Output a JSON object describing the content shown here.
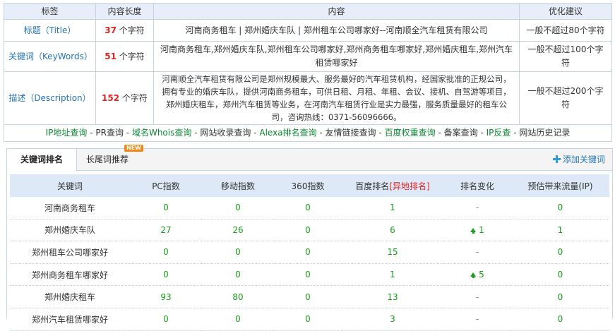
{
  "seo_table": {
    "headers": [
      "标签",
      "内容长度",
      "内容",
      "优化建议"
    ],
    "rows": [
      {
        "label": "标题（Title）",
        "count": "37",
        "unit": " 个字符",
        "content": "河南商务租车 | 郑州婚庆车队 | 郑州租车公司哪家好--河南顺全汽车租赁有限公司",
        "advice": "一般不超过80个字符"
      },
      {
        "label": "关键词（KeyWords）",
        "count": "51",
        "unit": " 个字符",
        "content": "河南商务租车,郑州婚庆车队,郑州租车公司哪家好,郑州商务租车哪家好,郑州婚庆租车,郑州汽车租赁哪家好",
        "advice": "一般不超过100个字符"
      },
      {
        "label": "描述（Description）",
        "count": "152",
        "unit": " 个字符",
        "content": "河南顺全汽车租赁有限公司是郑州规模最大、服务最好的汽车租赁机构，经国家批准的正规公司，拥有专业的婚庆车队，提供河南商务租车，可供日租、月租、年租、会议、接机、自驾游等项目，郑州婚庆租车，郑州汽车租赁等业务，在河南汽车租赁行业是实力最强，服务质量最好的租车公司，咨询热线：0371-56096666。",
        "advice": "一般不超过200个字符"
      }
    ],
    "tools": [
      {
        "label": "IP地址查询",
        "color": "green"
      },
      {
        "label": "PR查询",
        "color": "black"
      },
      {
        "label": "域名Whois查询",
        "color": "green"
      },
      {
        "label": "网站收录查询",
        "color": "black"
      },
      {
        "label": "Alexa排名查询",
        "color": "green"
      },
      {
        "label": "友情链接查询",
        "color": "black"
      },
      {
        "label": "百度权重查询",
        "color": "green"
      },
      {
        "label": "备案查询",
        "color": "black"
      },
      {
        "label": "IP反查",
        "color": "green"
      },
      {
        "label": "网站历史记录",
        "color": "black"
      }
    ],
    "tool_separator": "-"
  },
  "rank_panel": {
    "tabs": [
      "关键词排名",
      "长尾词推荐"
    ],
    "new_badge": "NEW",
    "add_keyword": "添加关键词",
    "headers": {
      "keyword": "关键词",
      "pc": "PC指数",
      "mobile": "移动指数",
      "s360": "360指数",
      "baidu_rank": "百度排名",
      "remote_rank": "[异地排名]",
      "trend": "排名变化",
      "traffic": "预估带来流量(IP)"
    },
    "rows": [
      {
        "keyword": "河南商务租车",
        "pc": "0",
        "mobile": "0",
        "s360": "0",
        "baidu": "1",
        "trend": "-",
        "trend_up": false,
        "traffic": "0"
      },
      {
        "keyword": "郑州婚庆车队",
        "pc": "27",
        "mobile": "26",
        "s360": "0",
        "baidu": "6",
        "trend": "1",
        "trend_up": true,
        "traffic": "1"
      },
      {
        "keyword": "郑州租车公司哪家好",
        "pc": "0",
        "mobile": "0",
        "s360": "0",
        "baidu": "15",
        "trend": "-",
        "trend_up": false,
        "traffic": "0"
      },
      {
        "keyword": "郑州商务租车哪家好",
        "pc": "0",
        "mobile": "0",
        "s360": "0",
        "baidu": "1",
        "trend": "5",
        "trend_up": true,
        "traffic": "0"
      },
      {
        "keyword": "郑州婚庆租车",
        "pc": "93",
        "mobile": "80",
        "s360": "0",
        "baidu": "13",
        "trend": "-",
        "trend_up": false,
        "traffic": "0"
      },
      {
        "keyword": "郑州汽车租赁哪家好",
        "pc": "0",
        "mobile": "0",
        "s360": "0",
        "baidu": "3",
        "trend": "-",
        "trend_up": false,
        "traffic": "0"
      }
    ]
  },
  "colors": {
    "accent_blue": "#2576b8",
    "count_red": "#e02222",
    "green": "#17a018",
    "header_bg": "#e7eef9"
  }
}
